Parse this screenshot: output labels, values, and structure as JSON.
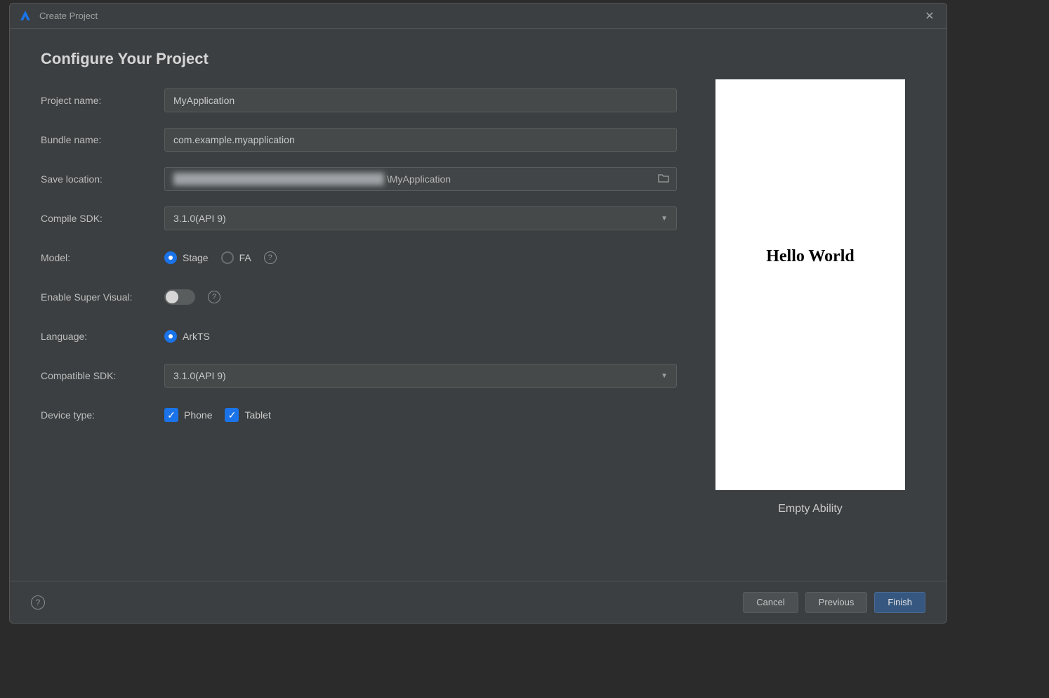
{
  "dialog": {
    "title": "Create Project",
    "page_heading": "Configure Your Project"
  },
  "form": {
    "project_name": {
      "label": "Project name:",
      "value": "MyApplication"
    },
    "bundle_name": {
      "label": "Bundle name:",
      "value": "com.example.myapplication"
    },
    "save_location": {
      "label": "Save location:",
      "value_suffix": "\\MyApplication"
    },
    "compile_sdk": {
      "label": "Compile SDK:",
      "value": "3.1.0(API 9)"
    },
    "model": {
      "label": "Model:",
      "options": [
        "Stage",
        "FA"
      ],
      "selected": "Stage"
    },
    "super_visual": {
      "label": "Enable Super Visual:",
      "enabled": false
    },
    "language": {
      "label": "Language:",
      "options": [
        "ArkTS"
      ],
      "selected": "ArkTS"
    },
    "compatible_sdk": {
      "label": "Compatible SDK:",
      "value": "3.1.0(API 9)"
    },
    "device_type": {
      "label": "Device type:",
      "options": [
        {
          "label": "Phone",
          "checked": true
        },
        {
          "label": "Tablet",
          "checked": true
        }
      ]
    }
  },
  "preview": {
    "text": "Hello World",
    "caption": "Empty Ability"
  },
  "buttons": {
    "cancel": "Cancel",
    "previous": "Previous",
    "finish": "Finish"
  }
}
